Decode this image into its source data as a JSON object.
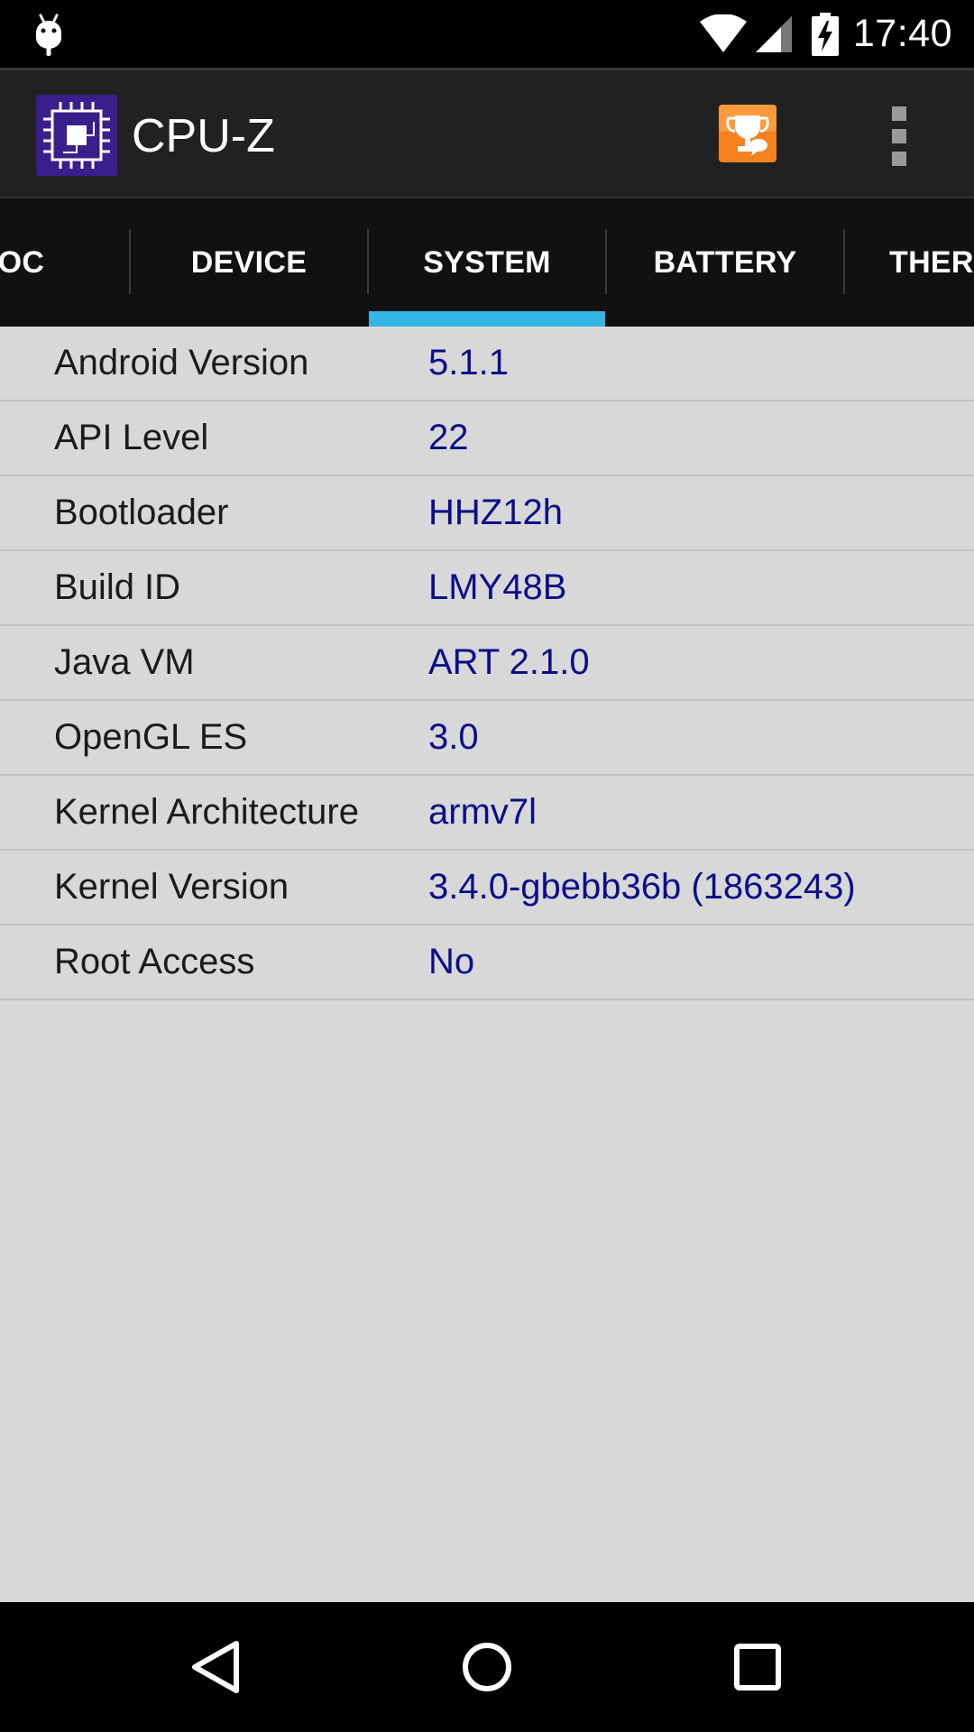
{
  "status_bar": {
    "time": "17:40",
    "icons": [
      "android-debug-icon",
      "wifi-icon",
      "cell-signal-icon",
      "battery-charging-icon"
    ]
  },
  "app": {
    "title": "CPU-Z",
    "logo_icon": "chip-icon",
    "actions": [
      "trophy-icon",
      "overflow-menu-icon"
    ],
    "colors": {
      "actionbar_bg": "#212121",
      "tab_indicator": "#33b5e5",
      "value_text": "#0d0d8a",
      "content_bg": "#d8d8d8",
      "trophy_orange": "#f5821f",
      "logo_purple": "#3a1e8c"
    }
  },
  "tabs": [
    {
      "label": "SOC"
    },
    {
      "label": "DEVICE"
    },
    {
      "label": "SYSTEM",
      "selected": true
    },
    {
      "label": "BATTERY"
    },
    {
      "label": "THERMAL"
    }
  ],
  "system_info": [
    {
      "label": "Android Version",
      "value": "5.1.1"
    },
    {
      "label": "API Level",
      "value": "22"
    },
    {
      "label": "Bootloader",
      "value": "HHZ12h"
    },
    {
      "label": "Build ID",
      "value": "LMY48B"
    },
    {
      "label": "Java VM",
      "value": "ART 2.1.0"
    },
    {
      "label": "OpenGL ES",
      "value": "3.0"
    },
    {
      "label": "Kernel Architecture",
      "value": "armv7l"
    },
    {
      "label": "Kernel Version",
      "value": "3.4.0-gbebb36b (1863243)"
    },
    {
      "label": "Root Access",
      "value": "No"
    }
  ],
  "nav_bar": [
    "back-icon",
    "home-icon",
    "recents-icon"
  ]
}
